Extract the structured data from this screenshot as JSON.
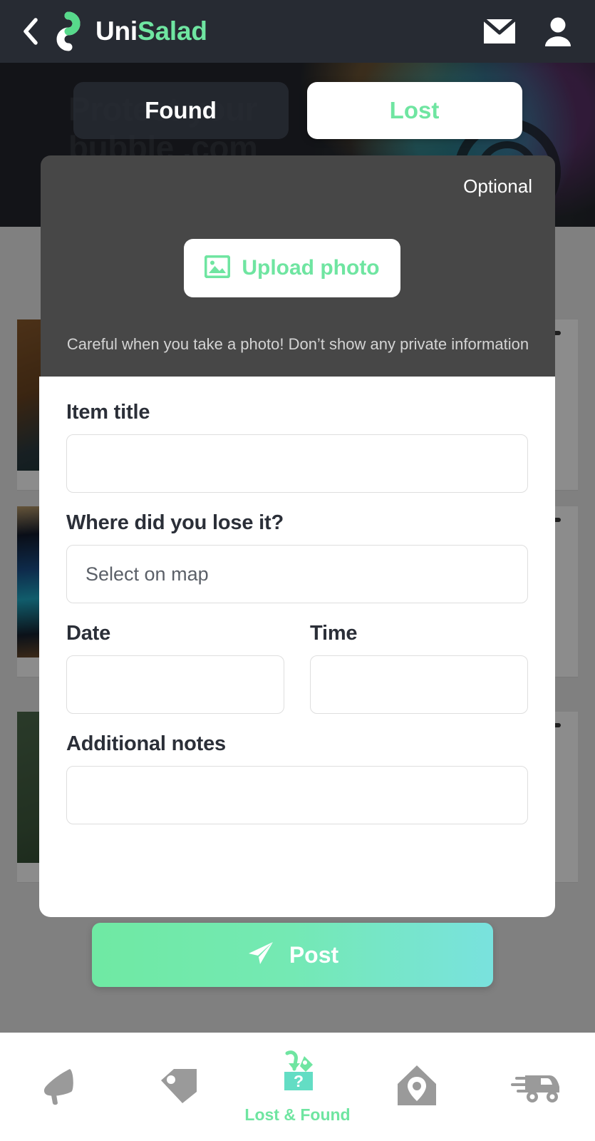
{
  "header": {
    "back_icon": "chevron-left-icon",
    "logo_icon": "unisalad-logo-icon",
    "brand_prefix": "Uni",
    "brand_suffix": "Salad",
    "mail_icon": "mail-icon",
    "profile_icon": "person-icon"
  },
  "banner": {
    "line1": "Protect your",
    "line2": "bubble .com"
  },
  "tabs": [
    {
      "label": "Found",
      "active": false
    },
    {
      "label": "Lost",
      "active": true
    }
  ],
  "modal": {
    "optional_label": "Optional",
    "upload": {
      "label": "Upload photo",
      "icon": "image-icon"
    },
    "photo_hint": "Careful when you take a photo! Don’t show any private information",
    "fields": {
      "item_title": {
        "label": "Item title",
        "value": "",
        "placeholder": ""
      },
      "location": {
        "label": "Where did you lose it?",
        "value": "",
        "placeholder": "Select on map"
      },
      "date": {
        "label": "Date",
        "value": "",
        "placeholder": ""
      },
      "time": {
        "label": "Time",
        "value": "",
        "placeholder": ""
      },
      "notes": {
        "label": "Additional notes",
        "value": "",
        "placeholder": ""
      }
    }
  },
  "post_button": {
    "label": "Post",
    "icon": "send-icon",
    "gradient_from": "#6fe9a3",
    "gradient_to": "#79e2de"
  },
  "bottom_nav": [
    {
      "name": "megaphone",
      "icon": "megaphone-icon",
      "label": "",
      "active": false
    },
    {
      "name": "tag",
      "icon": "tag-icon",
      "label": "",
      "active": false
    },
    {
      "name": "lost-and-found",
      "icon": "lost-found-box-icon",
      "label": "Lost & Found",
      "active": true
    },
    {
      "name": "housing",
      "icon": "home-pin-icon",
      "label": "",
      "active": false
    },
    {
      "name": "delivery",
      "icon": "delivery-truck-icon",
      "label": "",
      "active": false
    }
  ],
  "colors": {
    "accent_green": "#6fe5a1",
    "header_bg": "#272b33",
    "panel_bg": "#474747",
    "nav_inactive": "#9a9a9a"
  }
}
